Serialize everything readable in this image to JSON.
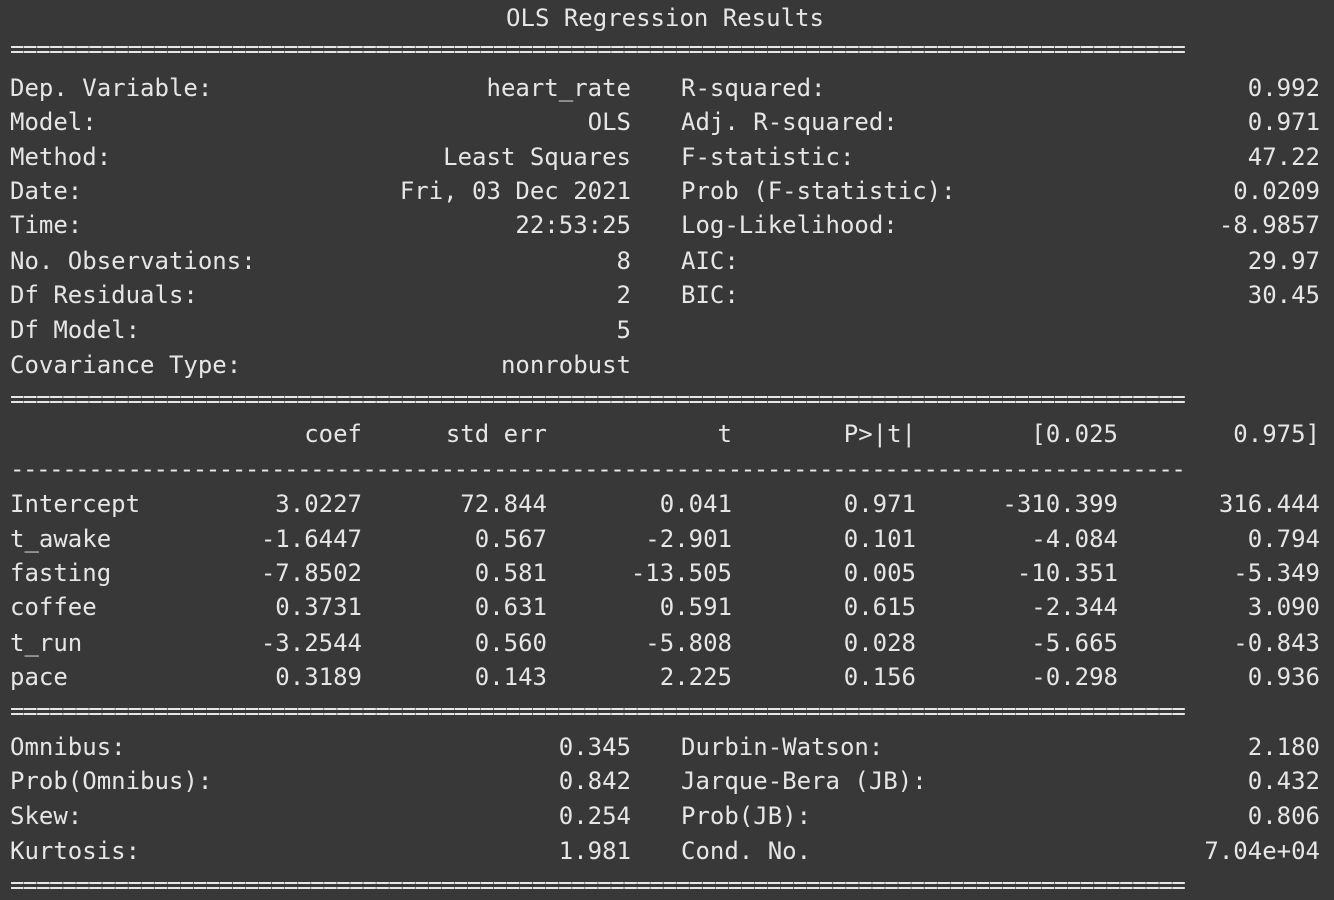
{
  "title": "OLS Regression Results",
  "rules": {
    "double": "==========================================================================================",
    "single": "------------------------------------------------------------------------------------------"
  },
  "model_info": {
    "left": [
      {
        "label": "Dep. Variable:",
        "value": "heart_rate"
      },
      {
        "label": "Model:",
        "value": "OLS"
      },
      {
        "label": "Method:",
        "value": "Least Squares"
      },
      {
        "label": "Date:",
        "value": "Fri, 03 Dec 2021"
      },
      {
        "label": "Time:",
        "value": "22:53:25"
      },
      {
        "label": "No. Observations:",
        "value": "8"
      },
      {
        "label": "Df Residuals:",
        "value": "2"
      },
      {
        "label": "Df Model:",
        "value": "5"
      },
      {
        "label": "Covariance Type:",
        "value": "nonrobust"
      }
    ],
    "right": [
      {
        "label": "R-squared:",
        "value": "0.992"
      },
      {
        "label": "Adj. R-squared:",
        "value": "0.971"
      },
      {
        "label": "F-statistic:",
        "value": "47.22"
      },
      {
        "label": "Prob (F-statistic):",
        "value": "0.0209"
      },
      {
        "label": "Log-Likelihood:",
        "value": "-8.9857"
      },
      {
        "label": "AIC:",
        "value": "29.97"
      },
      {
        "label": "BIC:",
        "value": "30.45"
      }
    ]
  },
  "coef_table": {
    "headers": [
      "coef",
      "std err",
      "t",
      "P>|t|",
      "[0.025",
      "0.975]"
    ],
    "rows": [
      {
        "name": "Intercept",
        "coef": "3.0227",
        "std_err": "72.844",
        "t": "0.041",
        "p": "0.971",
        "ci_low": "-310.399",
        "ci_high": "316.444"
      },
      {
        "name": "t_awake",
        "coef": "-1.6447",
        "std_err": "0.567",
        "t": "-2.901",
        "p": "0.101",
        "ci_low": "-4.084",
        "ci_high": "0.794"
      },
      {
        "name": "fasting",
        "coef": "-7.8502",
        "std_err": "0.581",
        "t": "-13.505",
        "p": "0.005",
        "ci_low": "-10.351",
        "ci_high": "-5.349"
      },
      {
        "name": "coffee",
        "coef": "0.3731",
        "std_err": "0.631",
        "t": "0.591",
        "p": "0.615",
        "ci_low": "-2.344",
        "ci_high": "3.090"
      },
      {
        "name": "t_run",
        "coef": "-3.2544",
        "std_err": "0.560",
        "t": "-5.808",
        "p": "0.028",
        "ci_low": "-5.665",
        "ci_high": "-0.843"
      },
      {
        "name": "pace",
        "coef": "0.3189",
        "std_err": "0.143",
        "t": "2.225",
        "p": "0.156",
        "ci_low": "-0.298",
        "ci_high": "0.936"
      }
    ]
  },
  "diagnostics": {
    "left": [
      {
        "label": "Omnibus:",
        "value": "0.345"
      },
      {
        "label": "Prob(Omnibus):",
        "value": "0.842"
      },
      {
        "label": "Skew:",
        "value": "0.254"
      },
      {
        "label": "Kurtosis:",
        "value": "1.981"
      }
    ],
    "right": [
      {
        "label": "Durbin-Watson:",
        "value": "2.180"
      },
      {
        "label": "Jarque-Bera (JB):",
        "value": "0.432"
      },
      {
        "label": "Prob(JB):",
        "value": "0.806"
      },
      {
        "label": "Cond. No.",
        "value": "7.04e+04"
      }
    ]
  }
}
